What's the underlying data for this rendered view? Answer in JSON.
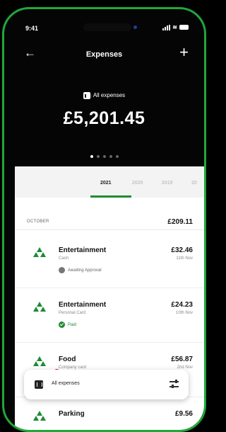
{
  "status_bar": {
    "time": "9:41"
  },
  "header": {
    "back_label": "←",
    "title": "Expenses",
    "add_label": "+"
  },
  "summary": {
    "label": "All expenses",
    "amount": "£5,201.45",
    "page_dots": 5,
    "active_dot": 0
  },
  "years": [
    "2021",
    "2020",
    "2019",
    "20"
  ],
  "active_year": "2021",
  "month": {
    "name": "OCTOBER",
    "total": "£209.11"
  },
  "expenses": [
    {
      "category": "Entertainment",
      "payment": "Cash",
      "amount": "£32.46",
      "date": "11th Nov",
      "status": "Awaiting Approval",
      "status_type": "pending"
    },
    {
      "category": "Entertainment",
      "payment": "Personal Card",
      "amount": "£24.23",
      "date": "10th Nov",
      "status": "Paid",
      "status_type": "paid"
    },
    {
      "category": "Food",
      "payment": "Company card",
      "amount": "£56.87",
      "date": "2nd Nov"
    },
    {
      "category": "Parking",
      "payment": "",
      "amount": "£9.56",
      "date": ""
    }
  ],
  "filter_bar": {
    "label": "All expenses"
  },
  "colors": {
    "accent": "#1d8b35",
    "frame": "#1fa83a",
    "background": "#050505"
  }
}
